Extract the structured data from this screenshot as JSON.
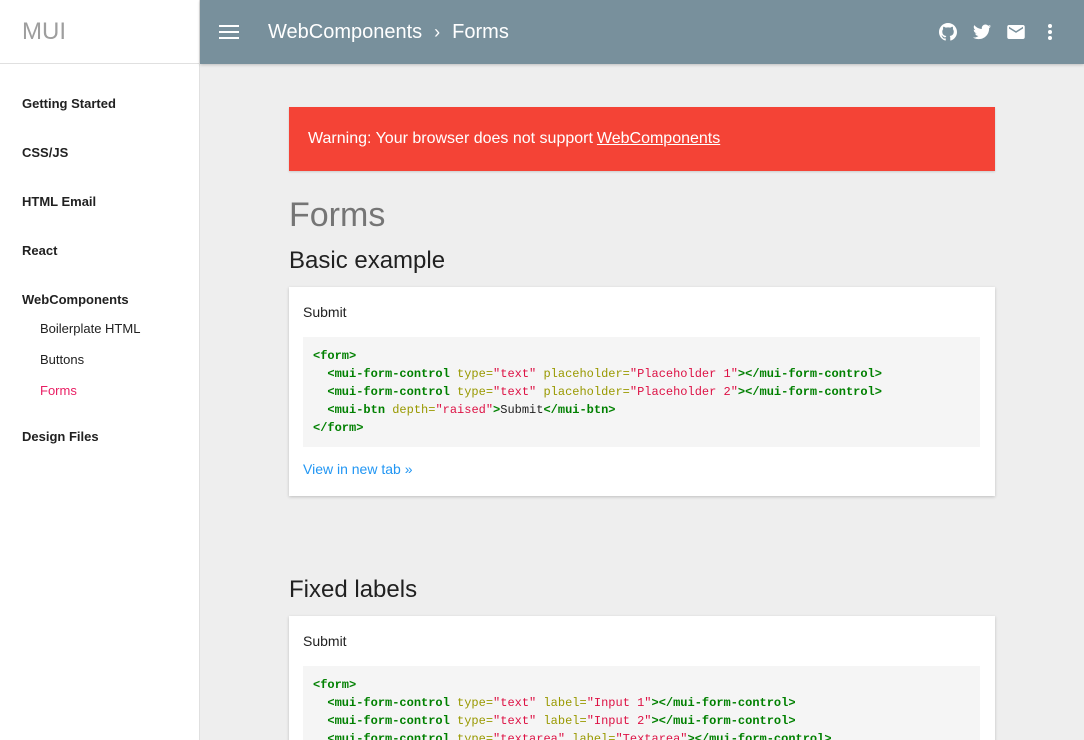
{
  "brand": "MUI",
  "sidebar": {
    "items": [
      {
        "label": "Getting Started"
      },
      {
        "label": "CSS/JS"
      },
      {
        "label": "HTML Email"
      },
      {
        "label": "React"
      },
      {
        "label": "WebComponents",
        "children": [
          {
            "label": "Boilerplate HTML"
          },
          {
            "label": "Buttons"
          },
          {
            "label": "Forms",
            "active": true
          }
        ]
      },
      {
        "label": "Design Files"
      }
    ]
  },
  "appbar": {
    "breadcrumb": [
      "WebComponents",
      "Forms"
    ],
    "separator": "›",
    "icons": [
      "github-icon",
      "twitter-icon",
      "mail-icon",
      "more-vert-icon"
    ],
    "color": "#78909c"
  },
  "warning": {
    "text": "Warning: Your browser does not support",
    "link": "WebComponents",
    "color": "#f44336"
  },
  "page_title": "Forms",
  "sections": [
    {
      "title": "Basic example",
      "submit_label": "Submit",
      "view_link": "View in new tab »",
      "code": {
        "open": "<form>",
        "lines": [
          {
            "tag": "mui-form-control",
            "attrs": [
              [
                "type",
                "text"
              ],
              [
                "placeholder",
                "Placeholder 1"
              ]
            ]
          },
          {
            "tag": "mui-form-control",
            "attrs": [
              [
                "type",
                "text"
              ],
              [
                "placeholder",
                "Placeholder 2"
              ]
            ]
          },
          {
            "tag": "mui-btn",
            "attrs": [
              [
                "depth",
                "raised"
              ]
            ],
            "inner": "Submit"
          }
        ],
        "close": "</form>"
      }
    },
    {
      "title": "Fixed labels",
      "submit_label": "Submit",
      "code": {
        "open": "<form>",
        "lines": [
          {
            "tag": "mui-form-control",
            "attrs": [
              [
                "type",
                "text"
              ],
              [
                "label",
                "Input 1"
              ]
            ]
          },
          {
            "tag": "mui-form-control",
            "attrs": [
              [
                "type",
                "text"
              ],
              [
                "label",
                "Input 2"
              ]
            ]
          },
          {
            "tag": "mui-form-control",
            "attrs": [
              [
                "type",
                "textarea"
              ],
              [
                "label",
                "Textarea"
              ]
            ]
          }
        ]
      }
    }
  ]
}
